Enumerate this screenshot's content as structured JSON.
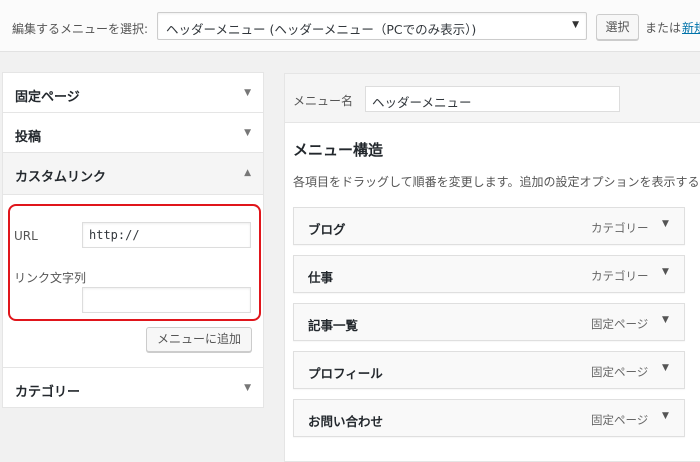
{
  "top_bar": {
    "select_label": "編集するメニューを選択:",
    "selected_menu": "ヘッダーメニュー (ヘッダーメニュー（PCでのみ表示）)",
    "select_button": "選択",
    "or_text": "または",
    "new_link": "新規"
  },
  "left_panel": {
    "sections": [
      {
        "title": "固定ページ",
        "arrow": "▼"
      },
      {
        "title": "投稿",
        "arrow": "▼"
      },
      {
        "title": "カスタムリンク",
        "arrow": "▲"
      },
      {
        "title": "カテゴリー",
        "arrow": "▼"
      }
    ],
    "custom_link": {
      "url_label": "URL",
      "url_value": "http://",
      "link_text_label": "リンク文字列",
      "link_text_value": "",
      "add_button": "メニューに追加"
    }
  },
  "right_panel": {
    "menu_name_label": "メニュー名",
    "menu_name_value": "ヘッダーメニュー",
    "structure_title": "メニュー構造",
    "structure_desc": "各項目をドラッグして順番を変更します。追加の設定オプションを表示する",
    "items": [
      {
        "title": "ブログ",
        "type": "カテゴリー"
      },
      {
        "title": "仕事",
        "type": "カテゴリー"
      },
      {
        "title": "記事一覧",
        "type": "固定ページ"
      },
      {
        "title": "プロフィール",
        "type": "固定ページ"
      },
      {
        "title": "お問い合わせ",
        "type": "固定ページ"
      }
    ]
  },
  "colors": {
    "highlight": "#e0151b",
    "link": "#0073aa",
    "background": "#f1f1f1"
  }
}
